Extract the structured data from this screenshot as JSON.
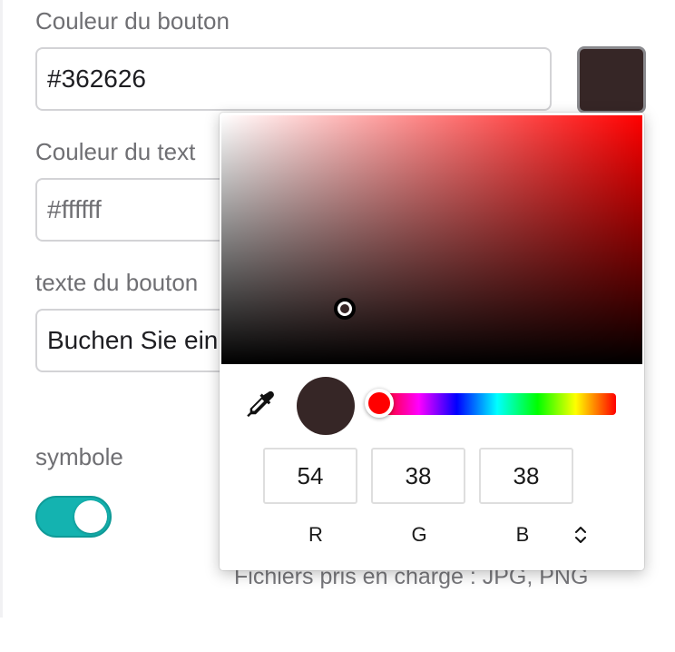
{
  "form": {
    "button_color_label": "Couleur du bouton",
    "button_color_value": "#362626",
    "text_color_label": "Couleur du text",
    "text_color_placeholder": "#ffffff",
    "button_text_label": "texte du bouton",
    "button_text_value": "Buchen Sie ein",
    "icon_label": "symbole",
    "icon_toggle_on": true,
    "supported_files": "Fichiers pris en charge : JPG, PNG"
  },
  "color_picker": {
    "current_color": "#362626",
    "hue_color": "#ff0000",
    "r": "54",
    "g": "38",
    "b": "38",
    "r_label": "R",
    "g_label": "G",
    "b_label": "B",
    "icons": [
      "eyedropper-icon",
      "chevron-up-down-icon"
    ]
  },
  "colors": {
    "toggle_accent": "#14b3b0",
    "swatch": "#362626"
  }
}
